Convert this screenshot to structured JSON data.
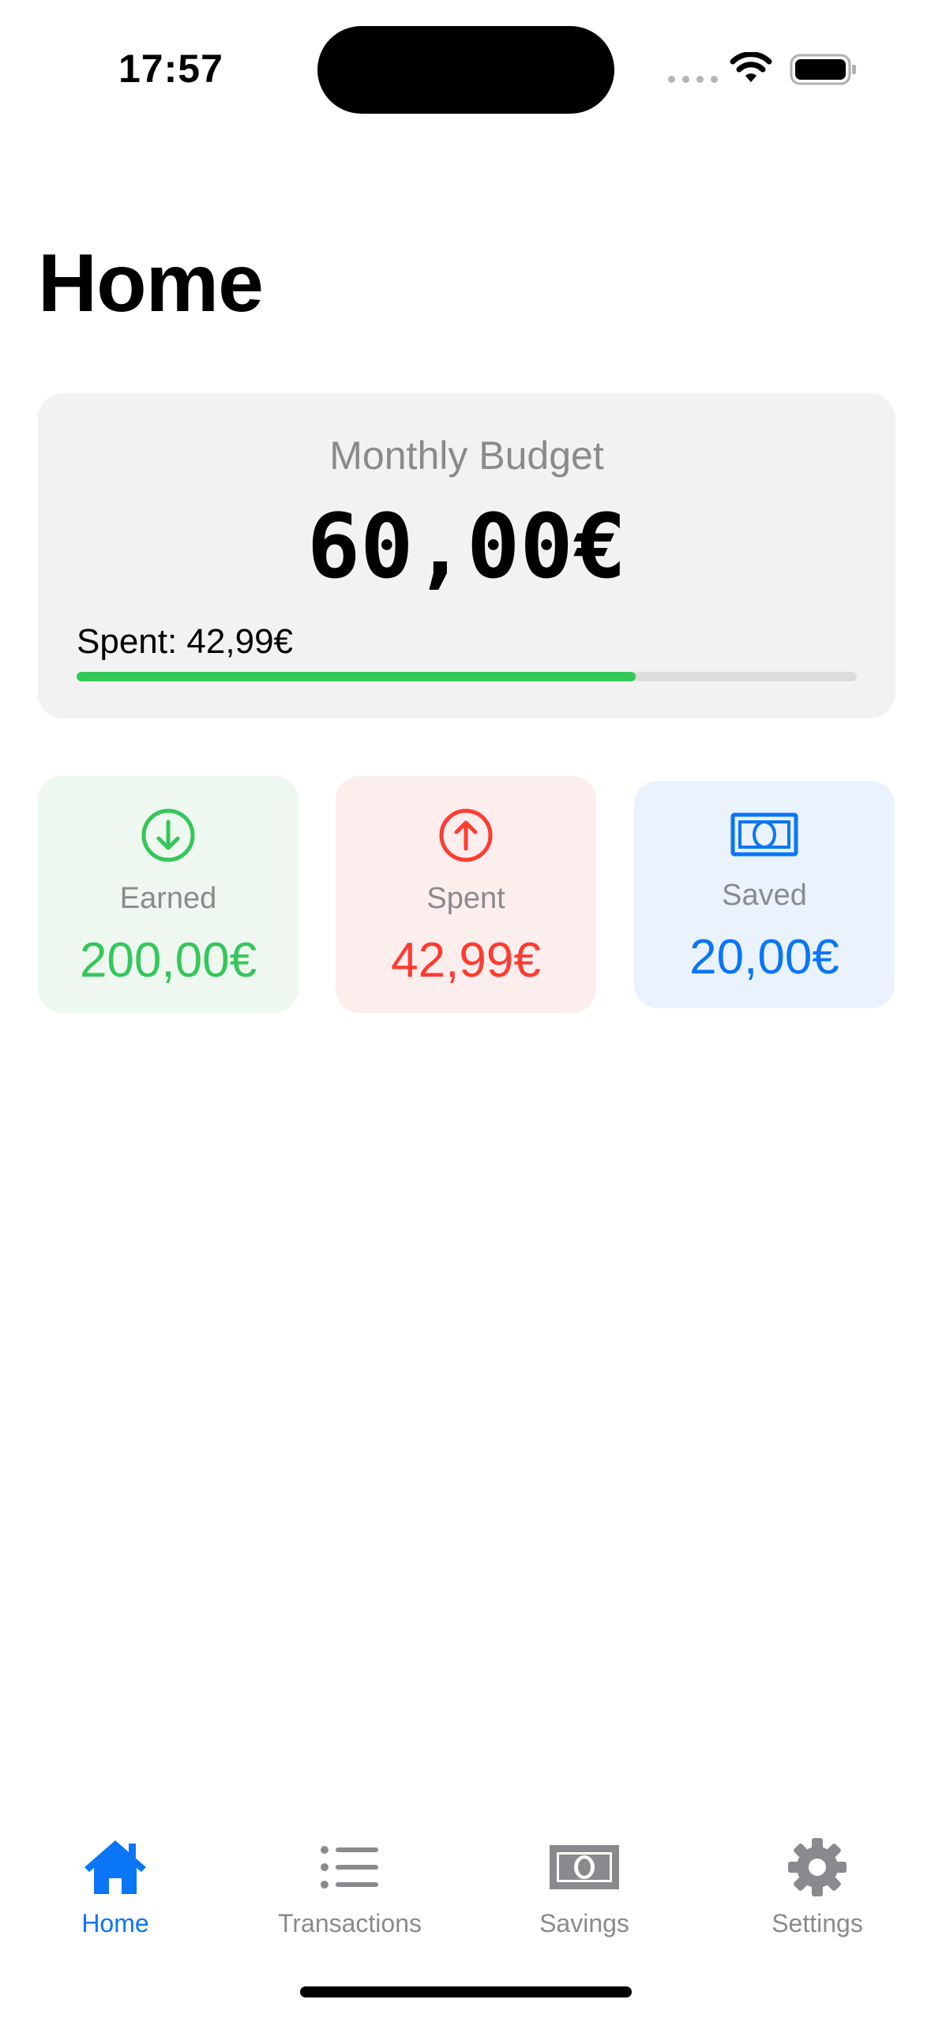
{
  "status_bar": {
    "time": "17:57"
  },
  "page": {
    "title": "Home"
  },
  "budget": {
    "title": "Monthly Budget",
    "amount": "60,00€",
    "spent_text": "Spent: 42,99€",
    "progress_fraction": 0.7165
  },
  "stats": {
    "earned": {
      "label": "Earned",
      "value": "200,00€",
      "color": "#34c759",
      "icon": "arrow-down-circle-icon"
    },
    "spent": {
      "label": "Spent",
      "value": "42,99€",
      "color": "#ff3b30",
      "icon": "arrow-up-circle-icon"
    },
    "saved": {
      "label": "Saved",
      "value": "20,00€",
      "color": "#0a76f6",
      "icon": "banknote-icon"
    }
  },
  "tab_bar": {
    "items": [
      {
        "label": "Home",
        "icon": "house-icon",
        "active": true
      },
      {
        "label": "Transactions",
        "icon": "list-icon",
        "active": false
      },
      {
        "label": "Savings",
        "icon": "banknote-icon",
        "active": false
      },
      {
        "label": "Settings",
        "icon": "gear-icon",
        "active": false
      }
    ]
  },
  "colors": {
    "accent": "#0a76f6",
    "inactive": "#8a8a8e",
    "progress": "#34c759"
  }
}
